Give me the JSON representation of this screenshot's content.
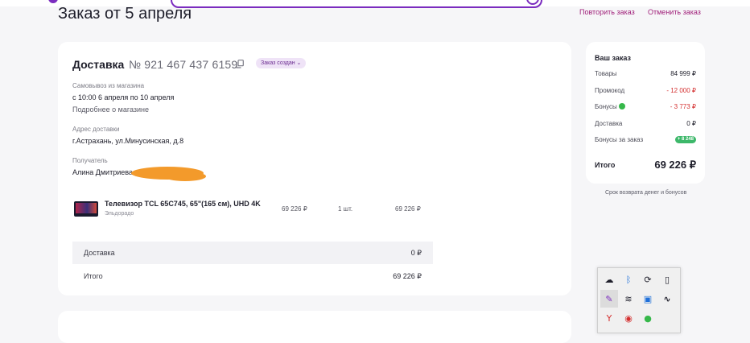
{
  "order": {
    "title": "Заказ от 5 апреля",
    "repeat_label": "Повторить заказ",
    "cancel_label": "Отменить заказ",
    "delivery_title": "Доставка",
    "order_number": "№ 921 467 437 6159",
    "status": "Заказ создан ⌄",
    "pickup_label": "Самовывоз из магазина",
    "pickup_dates": "с 10:00 6 апреля по 10 апреля",
    "store_link": "Подробнее о магазине",
    "address_label": "Адрес доставки",
    "address": "г.Астрахань, ул.Минусинская, д.8",
    "recipient_label": "Получатель",
    "recipient_name": "Алина Дмитриева"
  },
  "product": {
    "name": "Телевизор TCL 65C745, 65\"(165 см), UHD 4K",
    "seller": "Эльдорадо",
    "price": "69 226 ₽",
    "quantity": "1 шт.",
    "total": "69 226 ₽"
  },
  "totals": [
    {
      "label": "Доставка",
      "value": "0 ₽"
    },
    {
      "label": "Итого",
      "value": "69 226 ₽"
    }
  ],
  "summary": {
    "title": "Ваш заказ",
    "rows": [
      {
        "label": "Товары",
        "value": "84 999 ₽"
      },
      {
        "label": "Промокод",
        "value": "- 12 000 ₽"
      },
      {
        "label": "Бонусы",
        "value": "- 3 773 ₽"
      },
      {
        "label": "Доставка",
        "value": "0 ₽"
      },
      {
        "label": "Бонусы за заказ",
        "value": "+ 8 248"
      }
    ],
    "total_label": "Итого",
    "total_value": "69 226 ₽",
    "return_link": "Срок возврата денег и бонусов"
  },
  "tray": {
    "icons": [
      "cloud-icon",
      "bluetooth-icon",
      "sync-icon",
      "battery-icon",
      "pen-icon",
      "wifi-icon",
      "app-icon",
      "stylus-icon",
      "yandex-icon",
      "chrome-icon",
      "security-icon"
    ]
  },
  "colors": {
    "accent": "#7b2cbf",
    "link": "#a0207a",
    "negative": "#d43030",
    "bonus": "#36b84a"
  }
}
